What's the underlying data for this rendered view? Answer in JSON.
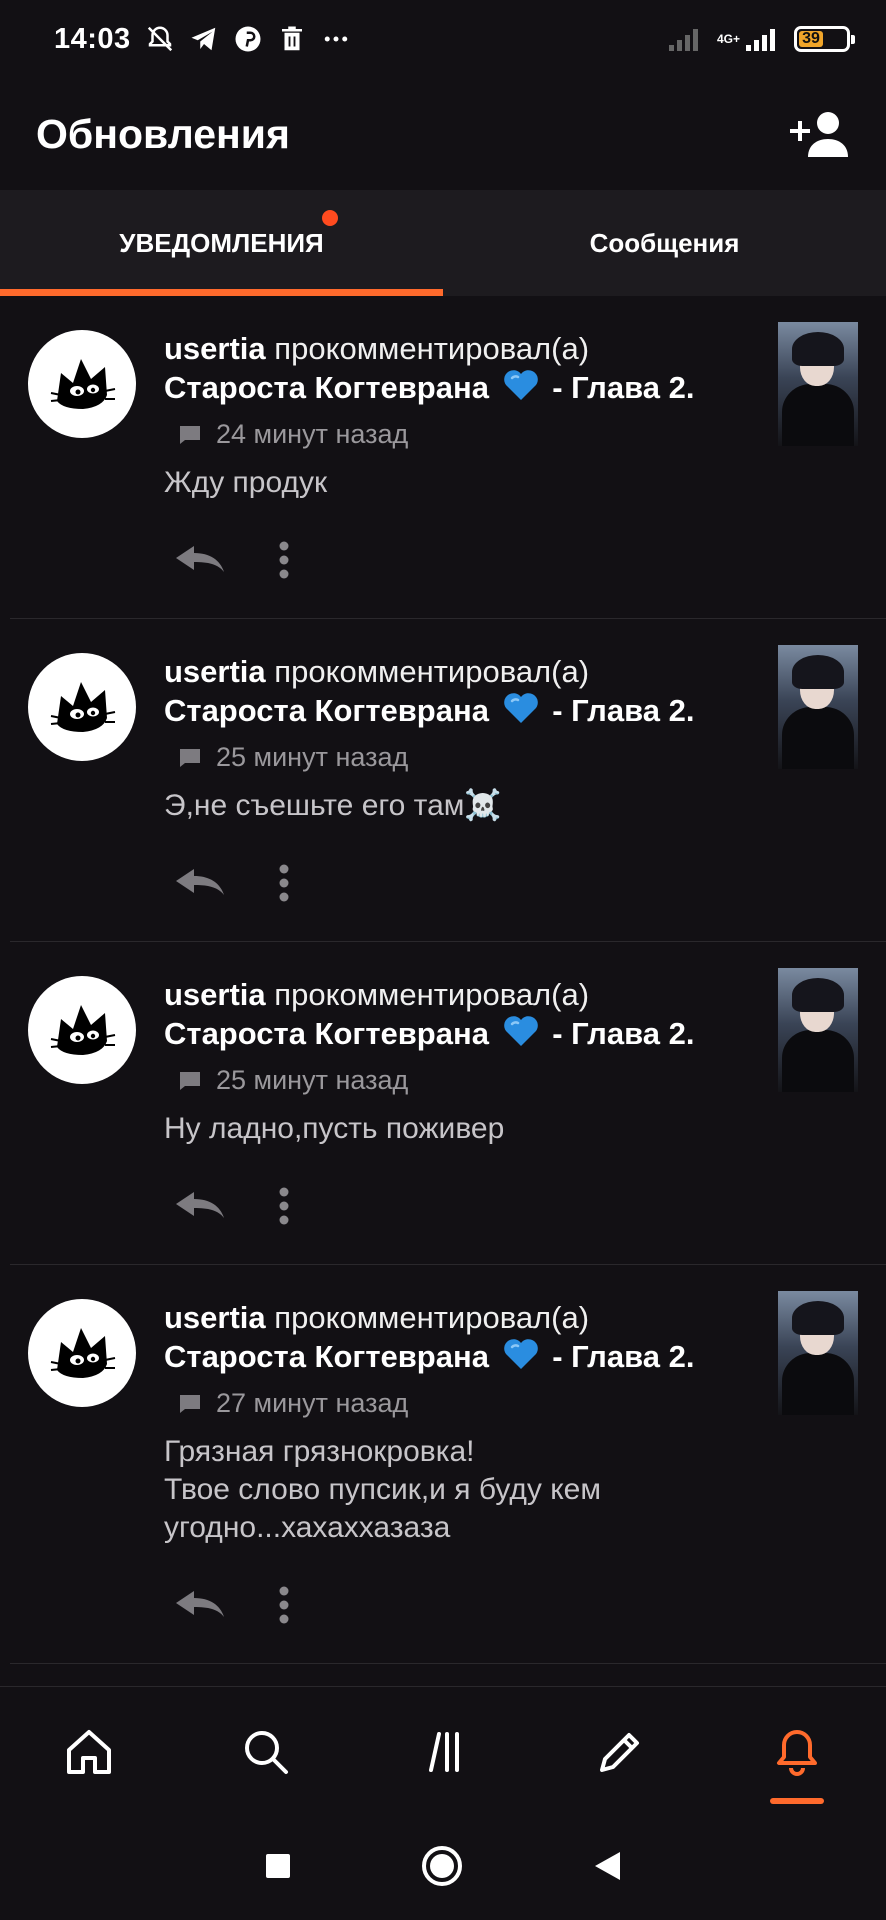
{
  "status_bar": {
    "time": "14:03",
    "icons": [
      "mute-bell-icon",
      "telegram-icon",
      "pinterest-icon",
      "trash-icon",
      "more-dots-icon",
      "signal-weak-icon",
      "4g-signal-icon"
    ],
    "network": "4G+",
    "battery": "39",
    "battery_level": 0.39
  },
  "header": {
    "title": "Обновления",
    "add_friend_icon": "add-person-icon"
  },
  "tabs": [
    {
      "label": "УВЕДОМЛЕНИЯ",
      "active": true,
      "has_dot": true
    },
    {
      "label": "Сообщения",
      "active": false,
      "has_dot": false
    }
  ],
  "colors": {
    "accent": "#ff6a2c",
    "background": "#121014",
    "tab_bar": "#1d1b1f",
    "muted_text": "#9a989c"
  },
  "notifications": [
    {
      "username": "usertia",
      "action": "прокомментировал(а)",
      "story": "Староста Когтеврана",
      "chapter": "- Глава 2.",
      "time": "24 минут назад",
      "comment": "Жду продук"
    },
    {
      "username": "usertia",
      "action": "прокомментировал(а)",
      "story": "Староста Когтеврана",
      "chapter": "- Глава 2.",
      "time": "25 минут назад",
      "comment": "Э,не съешьте его там☠️"
    },
    {
      "username": "usertia",
      "action": "прокомментировал(а)",
      "story": "Староста Когтеврана",
      "chapter": "- Глава 2.",
      "time": "25 минут назад",
      "comment": "Ну ладно,пусть поживер"
    },
    {
      "username": "usertia",
      "action": "прокомментировал(а)",
      "story": "Староста Когтеврана",
      "chapter": "- Глава 2.",
      "time": "27 минут назад",
      "comment": "Грязная грязнокровка!\nТвое слово пупсик,и я буду кем угодно...хахаххазаза"
    }
  ],
  "bottom_nav": [
    {
      "icon": "home-icon",
      "active": false
    },
    {
      "icon": "search-icon",
      "active": false
    },
    {
      "icon": "library-icon",
      "active": false
    },
    {
      "icon": "pencil-icon",
      "active": false
    },
    {
      "icon": "bell-icon",
      "active": true
    }
  ],
  "system_nav": [
    "recents-square-icon",
    "home-circle-icon",
    "back-triangle-icon"
  ]
}
